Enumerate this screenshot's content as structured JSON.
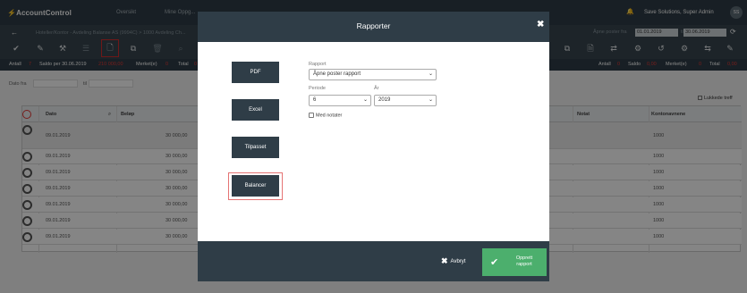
{
  "app": {
    "logo": "AccountControl",
    "nav_tabs": [
      "Oversikt",
      "Mine Oppg..."
    ]
  },
  "header": {
    "company_user": "Save Solutions, Super Admin",
    "avatar_initials": "SS"
  },
  "breadcrumb": "Hoteller/Kontor - Avdeling Balanse AS (9994C) > 1000 Avdeling Ch...",
  "filter": {
    "label": "Åpne poster fra",
    "date_from": "01.01.2019",
    "to_label": "til",
    "date_to": "30.06.2019"
  },
  "stats": {
    "antall_label": "Antall",
    "antall": "7",
    "saldo_label": "Saldo per 30.06.2019",
    "saldo": "210 000,00",
    "merket_label": "Merket(e)",
    "merket": "0",
    "total_label": "Total",
    "total": "0",
    "r_antall": "0",
    "r_saldo_label": "Saldo",
    "r_saldo": "0,00",
    "r_merket": "0",
    "r_total": "0,00"
  },
  "filters": {
    "dato_fra": "Dato fra",
    "til": "til",
    "lukkede": "Lukkede treff"
  },
  "table": {
    "headers": [
      "Dato",
      "Beløp",
      "Notat",
      "Kontonavnene"
    ],
    "rows": [
      {
        "date": "09.01.2019",
        "amount": "30 000,00",
        "account": "1000"
      },
      {
        "date": "09.01.2019",
        "amount": "30 000,00",
        "account": "1000"
      },
      {
        "date": "09.01.2019",
        "amount": "30 000,00",
        "account": "1000"
      },
      {
        "date": "09.01.2019",
        "amount": "30 000,00",
        "account": "1000"
      },
      {
        "date": "09.01.2019",
        "amount": "30 000,00",
        "account": "1000"
      },
      {
        "date": "09.01.2019",
        "amount": "30 000,00",
        "account": "1000"
      },
      {
        "date": "09.01.2019",
        "amount": "30 000,00",
        "account": "1000"
      }
    ]
  },
  "modal": {
    "title": "Rapporter",
    "report_buttons": [
      "PDF",
      "Excel",
      "Tilpasset",
      "Balancer"
    ],
    "rapport_label": "Rapport",
    "rapport_value": "Åpne poster rapport",
    "periode_label": "Periode",
    "periode_value": "6",
    "ar_label": "År",
    "ar_value": "2019",
    "med_notater": "Med notater",
    "cancel": "Avbryt",
    "submit_line1": "Opprett",
    "submit_line2": "rapport"
  },
  "colors": {
    "nav_dark": "#2f3d47",
    "accent_green": "#4caf6d",
    "highlight_red": "#d32f2f"
  }
}
